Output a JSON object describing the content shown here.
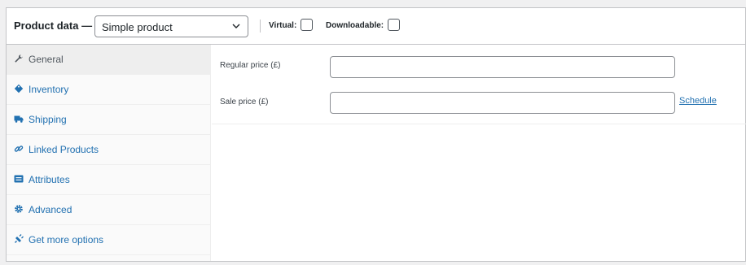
{
  "header": {
    "title": "Product data —",
    "product_type": "Simple product",
    "virtual_label": "Virtual:",
    "downloadable_label": "Downloadable:"
  },
  "tabs": [
    {
      "label": "General",
      "icon": "wrench-icon",
      "active": true
    },
    {
      "label": "Inventory",
      "icon": "tag-icon",
      "active": false
    },
    {
      "label": "Shipping",
      "icon": "truck-icon",
      "active": false
    },
    {
      "label": "Linked Products",
      "icon": "link-icon",
      "active": false
    },
    {
      "label": "Attributes",
      "icon": "list-icon",
      "active": false
    },
    {
      "label": "Advanced",
      "icon": "gear-icon",
      "active": false
    },
    {
      "label": "Get more options",
      "icon": "plug-icon",
      "active": false
    }
  ],
  "general": {
    "regular_price_label": "Regular price (£)",
    "regular_price_value": "",
    "sale_price_label": "Sale price (£)",
    "sale_price_value": "",
    "schedule_link": "Schedule"
  }
}
